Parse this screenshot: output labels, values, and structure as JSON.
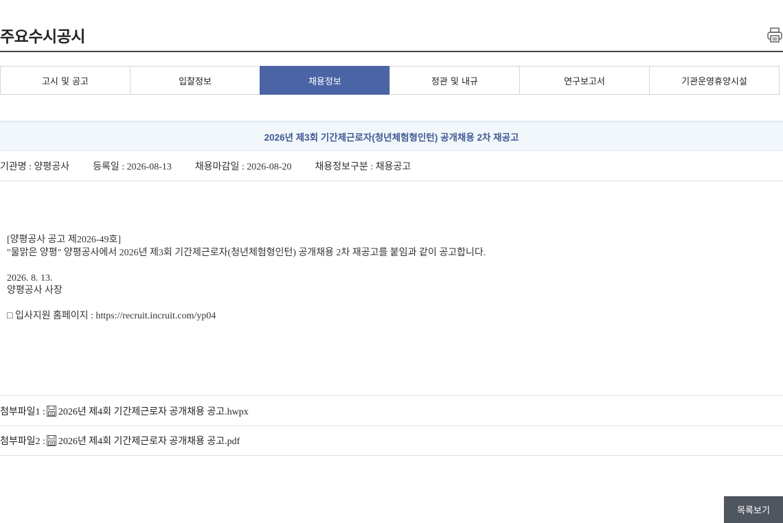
{
  "header": {
    "title": "주요수시공시",
    "print_icon": "printer-icon"
  },
  "tabs": [
    {
      "label": "고시 및 공고",
      "active": false
    },
    {
      "label": "입찰정보",
      "active": false
    },
    {
      "label": "채용정보",
      "active": true
    },
    {
      "label": "정관 및 내규",
      "active": false
    },
    {
      "label": "연구보고서",
      "active": false
    },
    {
      "label": "기관운영휴양시설",
      "active": false
    }
  ],
  "post": {
    "title": "2026년 제3회 기간제근로자(청년체험형인턴) 공개채용 2차 재공고",
    "meta": {
      "org": "기관명 : 양평공사",
      "reg_date": "등록일 : 2026-08-13",
      "deadline": "채용마감일 : 2026-08-20",
      "category": "채용정보구분 : 채용공고"
    },
    "body": [
      "[양평공사 공고 제2026-49호]",
      "\"물맑은 양평\" 양평공사에서 2026년 제3회 기간제근로자(청년체험형인턴) 공개채용 2차 재공고를 붙임과 같이 공고합니다.",
      "",
      "2026. 8. 13.",
      "양평공사 사장",
      "",
      "□ 입사지원 홈페이지 : https://recruit.incruit.com/yp04"
    ],
    "attachments": [
      {
        "label": "첨부파일1 :",
        "file": "2026년 제4회 기간제근로자 공개채용 공고.hwpx"
      },
      {
        "label": "첨부파일2 :",
        "file": "2026년 제4회 기간제근로자 공개채용 공고.pdf"
      }
    ]
  },
  "buttons": {
    "list_label": "목록보기"
  },
  "colors": {
    "accent": "#4a64a6",
    "title_bar_bg": "#f2f7fc",
    "title_text": "#3f5a92",
    "list_button_bg": "#505660"
  }
}
